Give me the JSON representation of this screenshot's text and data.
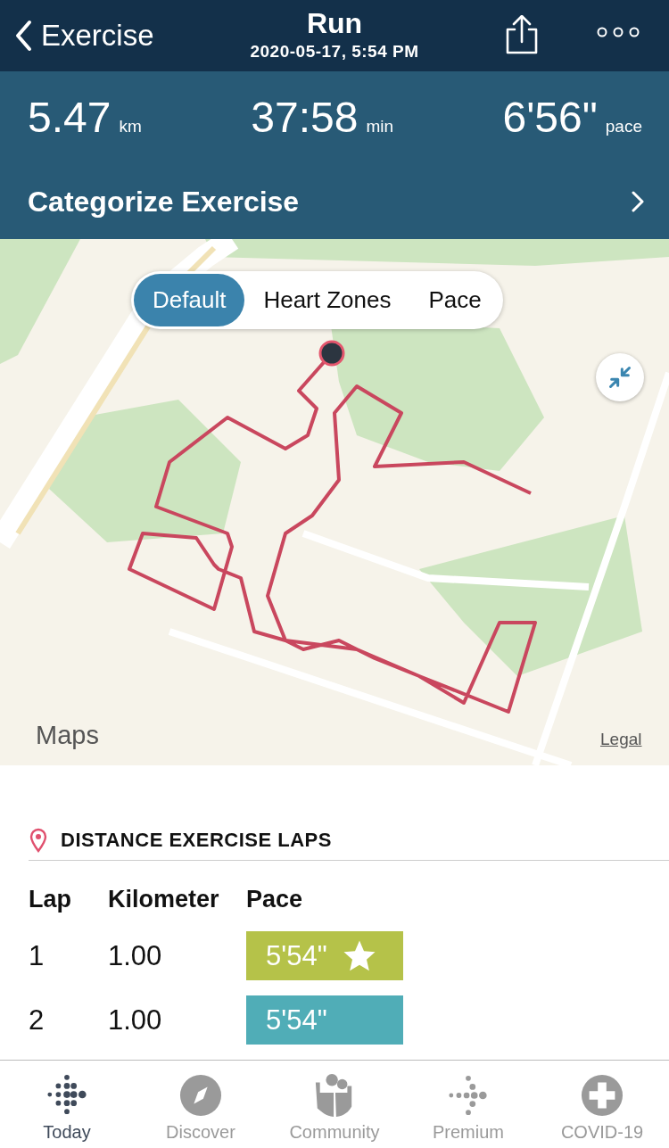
{
  "nav": {
    "back": "Exercise",
    "title": "Run",
    "subtitle": "2020-05-17, 5:54 PM"
  },
  "stats": [
    {
      "value": "5.47",
      "unit": "km"
    },
    {
      "value": "37:58",
      "unit": "min"
    },
    {
      "value": "6'56\"",
      "unit": "pace"
    }
  ],
  "categorize": "Categorize Exercise",
  "map": {
    "kind": "picture",
    "modes": [
      {
        "label": "Default",
        "selected": true
      },
      {
        "label": "Heart Zones",
        "selected": false
      },
      {
        "label": "Pace",
        "selected": false
      }
    ],
    "attribution": "Maps",
    "legal": "Legal"
  },
  "laps": {
    "title": "DISTANCE EXERCISE LAPS",
    "columns": [
      "Lap",
      "Kilometer",
      "Pace"
    ],
    "rows": [
      {
        "lap": "1",
        "km": "1.00",
        "pace": "5'54\"",
        "color": "#b5c249",
        "fastest": true
      },
      {
        "lap": "2",
        "km": "1.00",
        "pace": "5'54\"",
        "color": "#50adb7",
        "fastest": false
      }
    ]
  },
  "tabs": [
    {
      "label": "Today",
      "selected": true
    },
    {
      "label": "Discover",
      "selected": false
    },
    {
      "label": "Community",
      "selected": false
    },
    {
      "label": "Premium",
      "selected": false
    },
    {
      "label": "COVID-19",
      "selected": false
    }
  ]
}
